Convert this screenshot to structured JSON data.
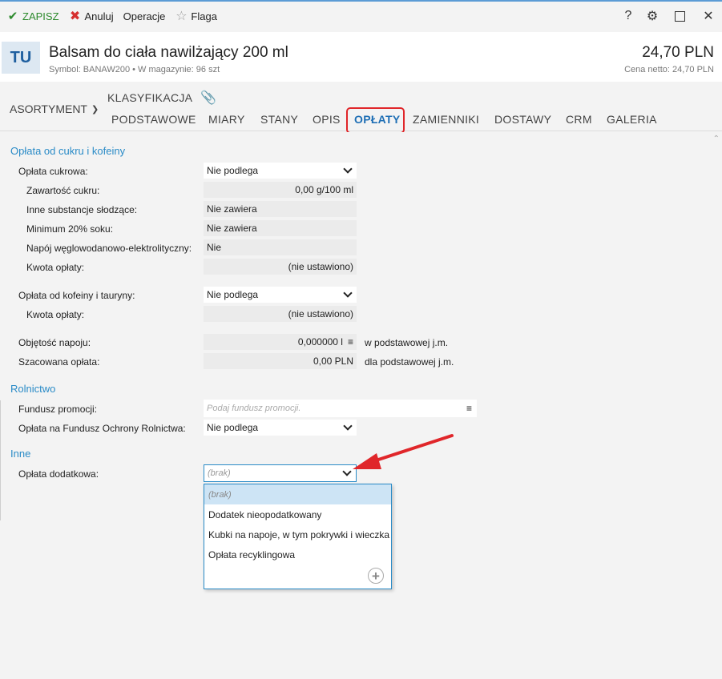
{
  "toolbar": {
    "save_label": "ZAPISZ",
    "cancel_label": "Anuluj",
    "operations_label": "Operacje",
    "flag_label": "Flaga",
    "help_label": "?"
  },
  "product": {
    "avatar": "TU",
    "title": "Balsam do ciała nawilżający 200 ml",
    "subtitle": "Symbol: BANAW200  •  W magazynie: 96 szt",
    "price": "24,70 PLN",
    "netto": "Cena netto: 24,70 PLN"
  },
  "nav": {
    "assortment_label": "ASORTYMENT",
    "classification_label": "KLASYFIKACJA",
    "tabs": [
      {
        "label": "PODSTAWOWE"
      },
      {
        "label": "MIARY"
      },
      {
        "label": "STANY"
      },
      {
        "label": "OPIS"
      },
      {
        "label": "OPŁATY"
      },
      {
        "label": "ZAMIENNIKI"
      },
      {
        "label": "DOSTAWY"
      },
      {
        "label": "CRM"
      },
      {
        "label": "GALERIA"
      }
    ],
    "active_tab": "OPŁATY"
  },
  "sugar": {
    "section_title": "Opłata od cukru i kofeiny",
    "fee_label": "Opłata cukrowa:",
    "fee_value": "Nie podlega",
    "sugar_content_label": "Zawartość cukru:",
    "sugar_content_value": "0,00 g/100 ml",
    "sweeteners_label": "Inne substancje słodzące:",
    "sweeteners_value": "Nie zawiera",
    "juice_label": "Minimum 20% soku:",
    "juice_value": "Nie zawiera",
    "isotonic_label": "Napój węglowodanowo-elektrolityczny:",
    "isotonic_value": "Nie",
    "amount_label": "Kwota opłaty:",
    "amount_value": "(nie ustawiono)",
    "caffeine_label": "Opłata od kofeiny i tauryny:",
    "caffeine_value": "Nie podlega",
    "caffeine_amount_label": "Kwota opłaty:",
    "caffeine_amount_value": "(nie ustawiono)",
    "volume_label": "Objętość napoju:",
    "volume_value": "0,000000 l",
    "volume_unit": "w podstawowej j.m.",
    "estimate_label": "Szacowana opłata:",
    "estimate_value": "0,00 PLN",
    "estimate_unit": "dla podstawowej j.m."
  },
  "agri": {
    "section_title": "Rolnictwo",
    "fund_label": "Fundusz promocji:",
    "fund_placeholder": "Podaj fundusz promocji.",
    "fofr_label": "Opłata na Fundusz Ochrony Rolnictwa:",
    "fofr_value": "Nie podlega"
  },
  "other": {
    "section_title": "Inne",
    "extra_fee_label": "Opłata dodatkowa:",
    "extra_fee_value": "(brak)",
    "options": [
      {
        "label": "(brak)"
      },
      {
        "label": "Dodatek nieopodatkowany"
      },
      {
        "label": "Kubki na napoje, w tym pokrywki i wieczka"
      },
      {
        "label": "Opłata recyklingowa"
      }
    ]
  },
  "colors": {
    "accent": "#2a8bc7",
    "highlight": "#e0262a",
    "save_green": "#2d8a2d"
  }
}
